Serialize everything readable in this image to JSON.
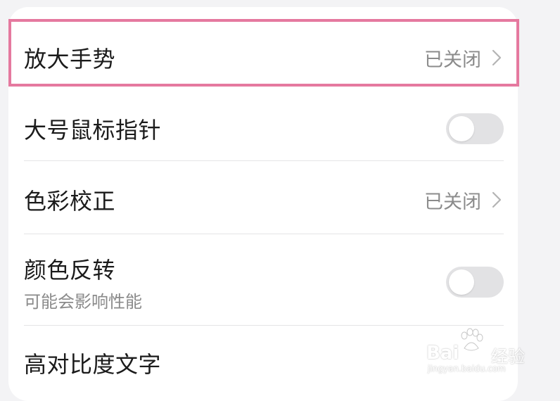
{
  "settings": {
    "rows": [
      {
        "title": "放大手势",
        "value": "已关闭",
        "control": "chevron"
      },
      {
        "title": "大号鼠标指针",
        "control": "toggle",
        "state": "off"
      },
      {
        "title": "色彩校正",
        "value": "已关闭",
        "control": "chevron"
      },
      {
        "title": "颜色反转",
        "subtitle": "可能会影响性能",
        "control": "toggle",
        "state": "off"
      },
      {
        "title": "高对比度文字"
      }
    ]
  },
  "icons": {
    "chevron": "chevron-right-icon",
    "watermark": "baidu-paw-logo"
  },
  "colors": {
    "highlight": "#e5799f",
    "toggle_off": "#e2e2e4",
    "secondary_text": "#8b8b8b"
  },
  "watermark": {
    "brand": "Bai",
    "brand_cn": "经验",
    "url": "jingyan.baidu.com"
  }
}
